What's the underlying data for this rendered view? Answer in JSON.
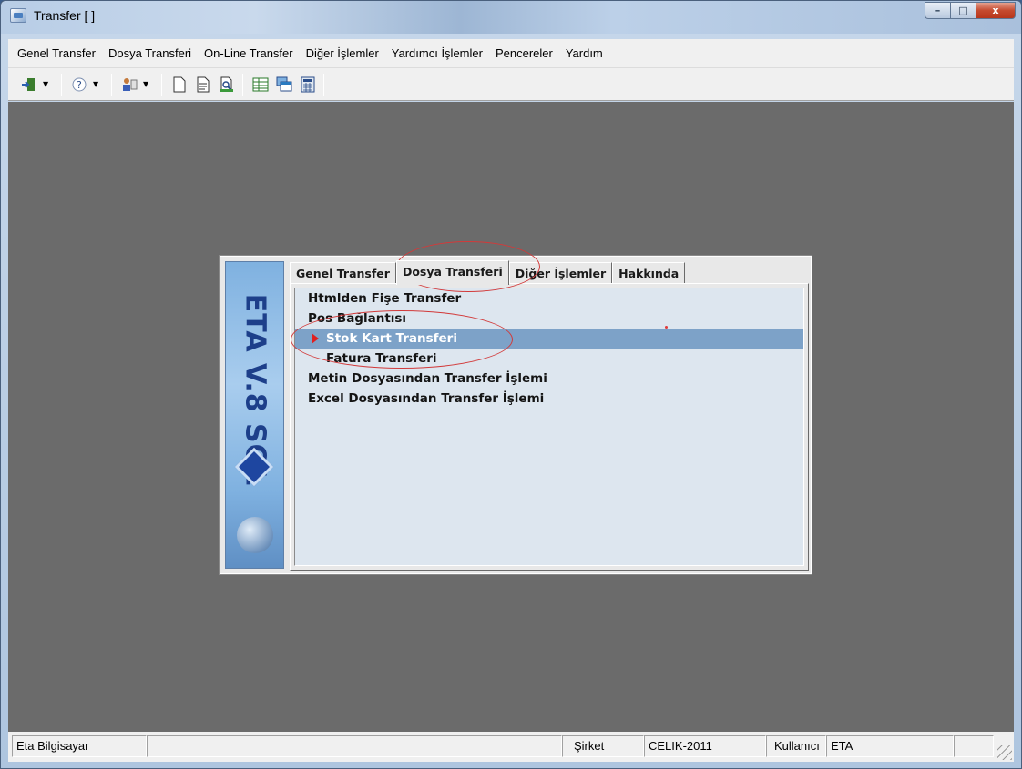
{
  "window": {
    "title": "Transfer [ ]",
    "controls": {
      "minimize": "–",
      "maximize": "□",
      "close": "x"
    }
  },
  "menu": {
    "items": [
      "Genel Transfer",
      "Dosya Transferi",
      "On-Line Transfer",
      "Diğer İşlemler",
      "Yardımcı İşlemler",
      "Pencereler",
      "Yardım"
    ]
  },
  "toolbar": {
    "icons": [
      "exit-icon",
      "help-icon",
      "user-icon",
      "new-document-icon",
      "document-icon",
      "print-preview-icon",
      "grid-icon",
      "windows-icon",
      "calculator-icon"
    ]
  },
  "dialog": {
    "logo_text": "ETA V.8 SQL",
    "tabs": [
      "Genel Transfer",
      "Dosya Transferi",
      "Diğer İşlemler",
      "Hakkında"
    ],
    "active_tab": 1,
    "list_items": [
      {
        "label": "Htmlden Fişe Transfer",
        "indent": false,
        "selected": false
      },
      {
        "label": "Pos Bağlantısı",
        "indent": false,
        "selected": false
      },
      {
        "label": "Stok Kart Transferi",
        "indent": true,
        "selected": true
      },
      {
        "label": "Fatura Transferi",
        "indent": true,
        "selected": false
      },
      {
        "label": "Metin Dosyasından Transfer İşlemi",
        "indent": false,
        "selected": false
      },
      {
        "label": "Excel Dosyasından Transfer İşlemi",
        "indent": false,
        "selected": false
      }
    ]
  },
  "status": {
    "company_name": "Eta Bilgisayar",
    "sirket_label": "Şirket",
    "sirket_value": "CELIK-2011",
    "kullanici_label": "Kullanıcı",
    "kullanici_value": "ETA"
  },
  "colors": {
    "mdi_background": "#6b6b6b",
    "selection": "#7da2c8",
    "annotation": "#d23a3a"
  }
}
